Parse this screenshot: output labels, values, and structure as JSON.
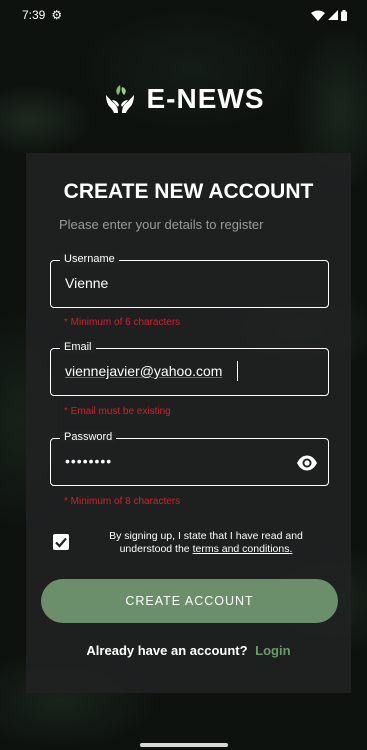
{
  "status_bar": {
    "time": "7:39"
  },
  "app": {
    "name": "E-NEWS"
  },
  "form": {
    "title": "CREATE NEW ACCOUNT",
    "subtitle": "Please enter your details to register",
    "username": {
      "label": "Username",
      "value": "Vienne",
      "hint": "* Minimum of 6 characters"
    },
    "email": {
      "label": "Email",
      "value": "viennejavier@yahoo.com",
      "hint": "* Email must be existing"
    },
    "password": {
      "label": "Password",
      "value": "••••••••",
      "hint": "* Minimum of 8 characters"
    },
    "terms": {
      "checked": true,
      "text_line1": "By signing up, I state that I have read and",
      "text_line2_prefix": "understood the ",
      "link": "terms and conditions."
    },
    "submit_label": "CREATE ACCOUNT",
    "login_prompt": "Already have an account?",
    "login_link": "Login"
  },
  "colors": {
    "accent_green": "#6b8f6b",
    "link_green": "#6b9a6b",
    "error_red": "#d0202e",
    "card_bg": "#202222"
  },
  "icons": {
    "status_left": "gear-icon",
    "status_right": [
      "wifi-icon",
      "signal-icon",
      "battery-icon"
    ],
    "logo": "hands-leaf-icon",
    "password_toggle": "eye-icon",
    "checkbox": "check-icon"
  }
}
